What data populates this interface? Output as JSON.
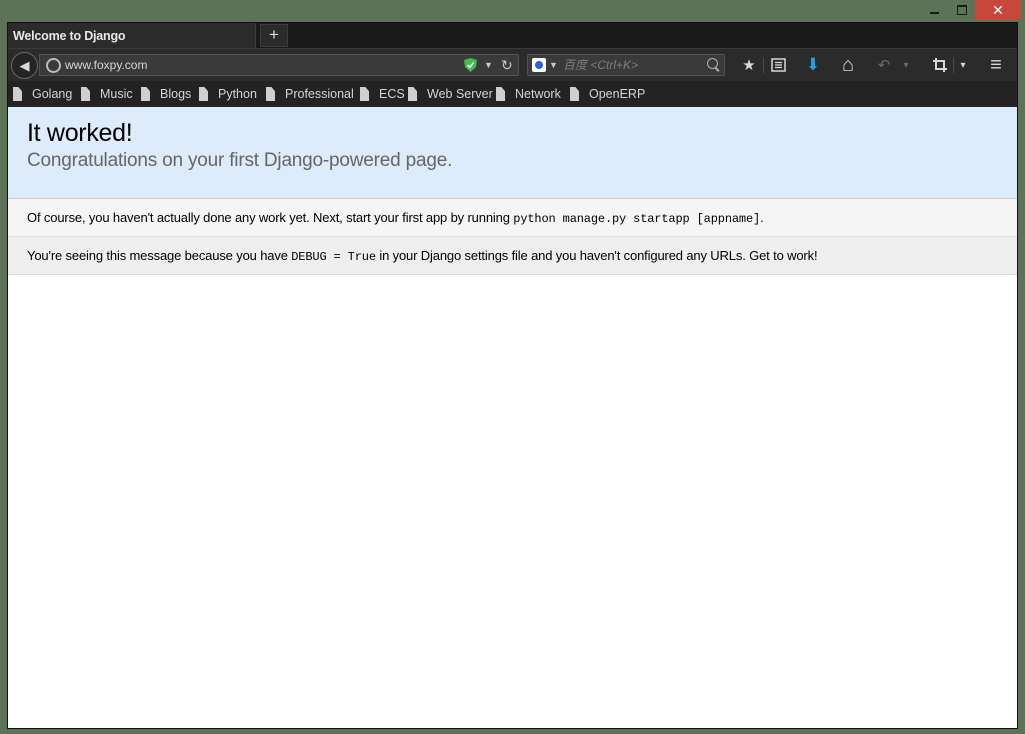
{
  "window": {
    "controls": {
      "minimize": "",
      "maximize": "",
      "close": "✕"
    }
  },
  "tabs": [
    {
      "label": "Welcome to Django",
      "active": true
    }
  ],
  "new_tab_label": "+",
  "navbar": {
    "back_icon": "◀",
    "url": "www.foxpy.com",
    "url_dropdown": "▼",
    "reload_icon": "↻",
    "search_engine_dropdown": "▼",
    "search_placeholder": "百度 <Ctrl+K>",
    "toolbar_icons": [
      "bookmark-star-icon",
      "reading-list-icon",
      "download-icon",
      "home-icon",
      "undo-icon",
      "crop-icon",
      "menu-icon"
    ],
    "toolbar_glyphs": {
      "star": "★",
      "download": "⬇",
      "home": "⌂",
      "undo": "↶",
      "menu": "≡",
      "dropdown": "▾"
    },
    "accent_colors": {
      "shield": "#3bbf4a",
      "download": "#1aa3e8"
    }
  },
  "bookmarks": [
    {
      "label": "Golang"
    },
    {
      "label": "Music"
    },
    {
      "label": "Blogs"
    },
    {
      "label": "Python"
    },
    {
      "label": "Professional"
    },
    {
      "label": "ECS"
    },
    {
      "label": "Web Server"
    },
    {
      "label": "Network"
    },
    {
      "label": "OpenERP"
    }
  ],
  "page": {
    "title": "It worked!",
    "subtitle": "Congratulations on your first Django-powered page.",
    "instructions_pre": "Of course, you haven't actually done any work yet. Next, start your first app by running ",
    "instructions_code": "python manage.py startapp [appname]",
    "instructions_post": ".",
    "explanation_pre": "You're seeing this message because you have ",
    "explanation_code": "DEBUG = True",
    "explanation_post": " in your Django settings file and you haven't configured any URLs. Get to work!"
  }
}
